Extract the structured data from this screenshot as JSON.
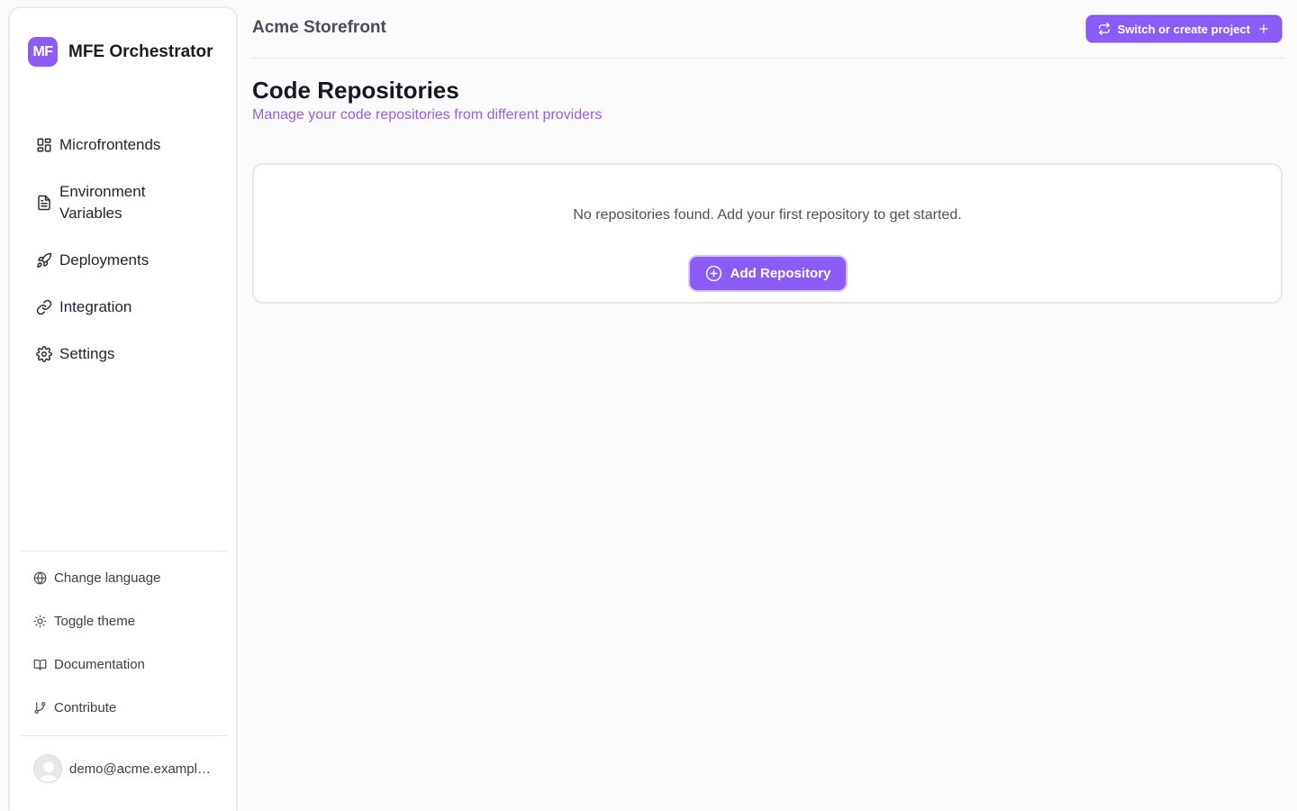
{
  "brand": {
    "logo": "MF",
    "name": "MFE Orchestrator",
    "accent": "#8b5cf6"
  },
  "sidebar": {
    "items": [
      {
        "label": "Microfrontends",
        "icon": "grid-icon"
      },
      {
        "label": "Environment Variables",
        "icon": "file-text-icon"
      },
      {
        "label": "Deployments",
        "icon": "rocket-icon"
      },
      {
        "label": "Integration",
        "icon": "link-icon"
      },
      {
        "label": "Settings",
        "icon": "gear-icon"
      }
    ],
    "utilities": [
      {
        "label": "Change language",
        "icon": "globe-icon"
      },
      {
        "label": "Toggle theme",
        "icon": "sun-icon"
      },
      {
        "label": "Documentation",
        "icon": "book-icon"
      },
      {
        "label": "Contribute",
        "icon": "git-branch-icon"
      }
    ],
    "user": {
      "email": "demo@acme.example.com"
    }
  },
  "header": {
    "project": "Acme Storefront",
    "switch_label": "Switch or create project"
  },
  "main": {
    "title": "Code Repositories",
    "subtitle": "Manage your code repositories from different providers",
    "empty_message": "No repositories found. Add your first repository to get started.",
    "add_label": "Add Repository"
  }
}
